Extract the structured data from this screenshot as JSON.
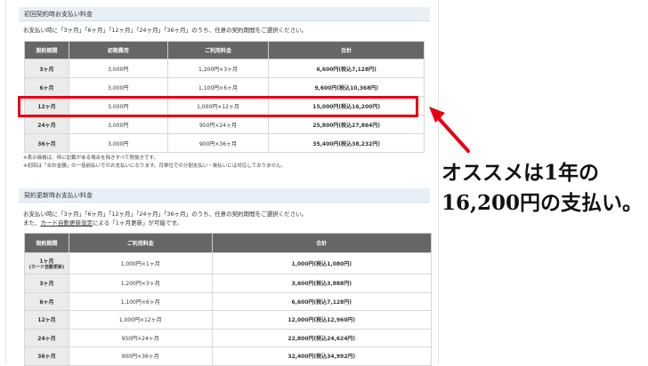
{
  "section1": {
    "title": "初回契約時お支払い料金",
    "description": "お支払い時に「3ヶ月」「6ヶ月」「12ヶ月」「24ヶ月」「36ヶ月」のうち、任意の契約期間をご選択ください。",
    "headers": [
      "契約期間",
      "初期費用",
      "ご利用料金",
      "合計"
    ],
    "rows": [
      {
        "period": "3ヶ月",
        "initial": "3,000円",
        "fee": "1,200円×3ヶ月",
        "total": "6,600円(税込7,128円)"
      },
      {
        "period": "6ヶ月",
        "initial": "3,000円",
        "fee": "1,100円×6ヶ月",
        "total": "9,600円(税込10,368円)"
      },
      {
        "period": "12ヶ月",
        "initial": "3,000円",
        "fee": "1,000円×12ヶ月",
        "total": "15,000円(税込16,200円)"
      },
      {
        "period": "24ヶ月",
        "initial": "3,000円",
        "fee": "950円×24ヶ月",
        "total": "25,800円(税込27,864円)"
      },
      {
        "period": "36ヶ月",
        "initial": "3,000円",
        "fee": "900円×36ヶ月",
        "total": "35,400円(税込38,232円)"
      }
    ],
    "note1": "※表示価格は、特に記載がある場合を除きすべて税抜きです。",
    "note2": "※初回は「合計金額」の一括前払いでのお支払いになります。月単位での分割支払い・後払いには対応しておりません。"
  },
  "section2": {
    "title": "契約更新時お支払い料金",
    "description": "お支払い時に「3ヶ月」「6ヶ月」「12ヶ月」「24ヶ月」「36ヶ月」のうち、任意の契約期間をご選択ください。",
    "desc2_pre": "また、",
    "desc2_link": "カード自動更新設定",
    "desc2_post": "による「1ヶ月更新」が可能です。",
    "headers": [
      "契約期間",
      "ご利用料金",
      "合計"
    ],
    "rows": [
      {
        "period": "1ヶ月",
        "sub": "(カード自動更新)",
        "fee": "1,000円×1ヶ月",
        "total": "1,000円(税込1,080円)"
      },
      {
        "period": "3ヶ月",
        "sub": "",
        "fee": "1,200円×3ヶ月",
        "total": "3,600円(税込3,888円)"
      },
      {
        "period": "6ヶ月",
        "sub": "",
        "fee": "1,100円×6ヶ月",
        "total": "6,600円(税込7,128円)"
      },
      {
        "period": "12ヶ月",
        "sub": "",
        "fee": "1,000円×12ヶ月",
        "total": "12,000円(税込12,960円)"
      },
      {
        "period": "24ヶ月",
        "sub": "",
        "fee": "950円×24ヶ月",
        "total": "22,800円(税込24,624円)"
      },
      {
        "period": "36ヶ月",
        "sub": "",
        "fee": "900円×36ヶ月",
        "total": "32,400円(税込34,992円)"
      }
    ]
  },
  "callout": {
    "line1": "オススメは1年の",
    "line2": "16,200円の支払い。"
  },
  "colors": {
    "highlight": "#e60012",
    "header_bg": "#666666",
    "label_bg": "#ebebeb",
    "section_bg": "#e9f0f5"
  }
}
